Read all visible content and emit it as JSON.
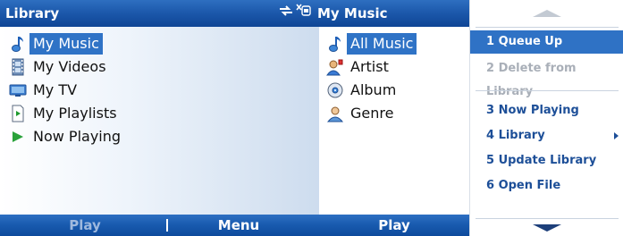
{
  "left_pane": {
    "title": "Library",
    "items": [
      {
        "label": "My Music",
        "icon": "music-note-icon",
        "selected": true
      },
      {
        "label": "My Videos",
        "icon": "film-icon",
        "selected": false
      },
      {
        "label": "My TV",
        "icon": "tv-icon",
        "selected": false
      },
      {
        "label": "My Playlists",
        "icon": "playlist-icon",
        "selected": false
      },
      {
        "label": "Now Playing",
        "icon": "play-icon",
        "selected": false
      }
    ],
    "softkeys": {
      "left": "Play",
      "right": "Menu"
    }
  },
  "right_pane": {
    "title": "My Music",
    "title_icons": [
      "sync-icon",
      "usb-icon"
    ],
    "items": [
      {
        "label": "All Music",
        "icon": "music-note-icon",
        "selected": true
      },
      {
        "label": "Artist",
        "icon": "artist-icon",
        "selected": false
      },
      {
        "label": "Album",
        "icon": "album-icon",
        "selected": false
      },
      {
        "label": "Genre",
        "icon": "genre-icon",
        "selected": false
      }
    ],
    "softkey": "Play"
  },
  "menu": {
    "items": [
      {
        "label": "1 Queue Up",
        "state": "highlighted"
      },
      {
        "label": "2 Delete from Library",
        "state": "disabled"
      },
      {
        "label": "3 Now Playing",
        "state": "normal"
      },
      {
        "label": "4 Library",
        "state": "normal",
        "has_submenu": true
      },
      {
        "label": "5 Update Library",
        "state": "normal"
      },
      {
        "label": "6 Open File",
        "state": "normal"
      }
    ]
  },
  "colors": {
    "title_bar": "#1b57aa",
    "selection": "#2f73c6",
    "menu_text": "#1d4f98",
    "menu_disabled": "#a9afb8"
  }
}
